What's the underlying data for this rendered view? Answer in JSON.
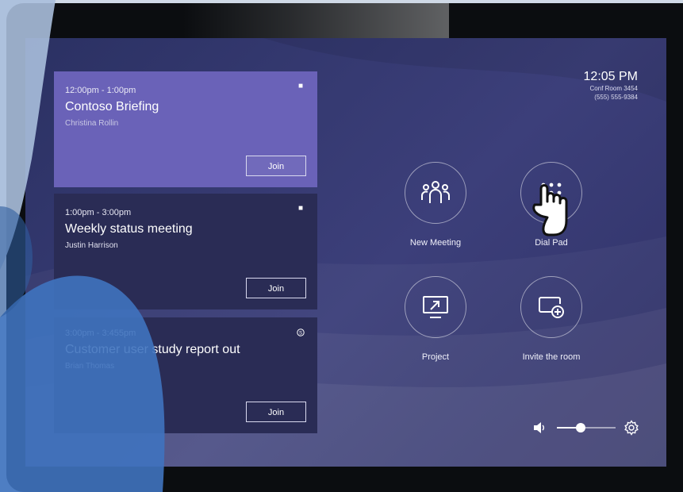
{
  "meetings": [
    {
      "time": "12:00pm - 1:00pm",
      "title": "Contoso Briefing",
      "organizer": "Christina Rollin",
      "join_label": "Join",
      "app": "teams-icon"
    },
    {
      "time": "1:00pm - 3:00pm",
      "title": "Weekly status meeting",
      "organizer": "Justin Harrison",
      "join_label": "Join",
      "app": "teams-icon"
    },
    {
      "time": "3:00pm - 3:455pm",
      "title": "Customer user study report out",
      "organizer": "Brian Thomas",
      "join_label": "Join",
      "app": "skype-icon"
    }
  ],
  "clock": {
    "time": "12:05 PM",
    "room": "Conf Room 3454",
    "phone": "(555) 555-9384"
  },
  "actions": [
    {
      "label": "New Meeting",
      "icon": "people-icon"
    },
    {
      "label": "Dial Pad",
      "icon": "dial-pad-icon"
    },
    {
      "label": "Project",
      "icon": "project-screen-icon"
    },
    {
      "label": "Invite the room",
      "icon": "invite-room-icon"
    }
  ],
  "volume": {
    "level": 0.4,
    "icon": "speaker-icon"
  },
  "settings": {
    "icon": "gear-icon"
  },
  "colors": {
    "accent": "#6a62b8",
    "card": "#2a2c55",
    "screen": "#363a72",
    "overlay_blue": "#3f73bf"
  }
}
